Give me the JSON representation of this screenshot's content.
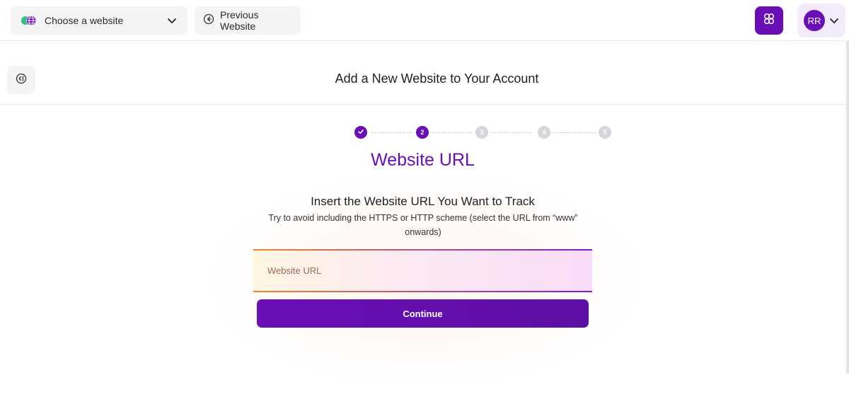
{
  "topbar": {
    "site_select_label": "Choose a website",
    "site_icon": "globe-icon",
    "previous_label": "Previous Website",
    "previous_icon": "arrow-left-circle-icon",
    "ai_icon": "assistant-icon",
    "user_initials": "RR"
  },
  "header": {
    "back_icon": "collapse-left-icon",
    "title": "Add a New Website to Your Account"
  },
  "stepper": {
    "steps": [
      {
        "label": "",
        "state": "done"
      },
      {
        "label": "2",
        "state": "active"
      },
      {
        "label": "3",
        "state": "todo"
      },
      {
        "label": "4",
        "state": "todo"
      },
      {
        "label": "5",
        "state": "todo"
      }
    ]
  },
  "form": {
    "step_title": "Website URL",
    "heading": "Insert the Website URL You Want to Track",
    "hint": "Try to avoid including the HTTPS or HTTP scheme (select the URL from “www” onwards)",
    "url_placeholder": "Website URL",
    "url_value": "",
    "continue_label": "Continue"
  },
  "colors": {
    "accent": "#6a0fb8",
    "field_border_left": "#f0882a",
    "field_border_right": "#7a1cd0"
  }
}
